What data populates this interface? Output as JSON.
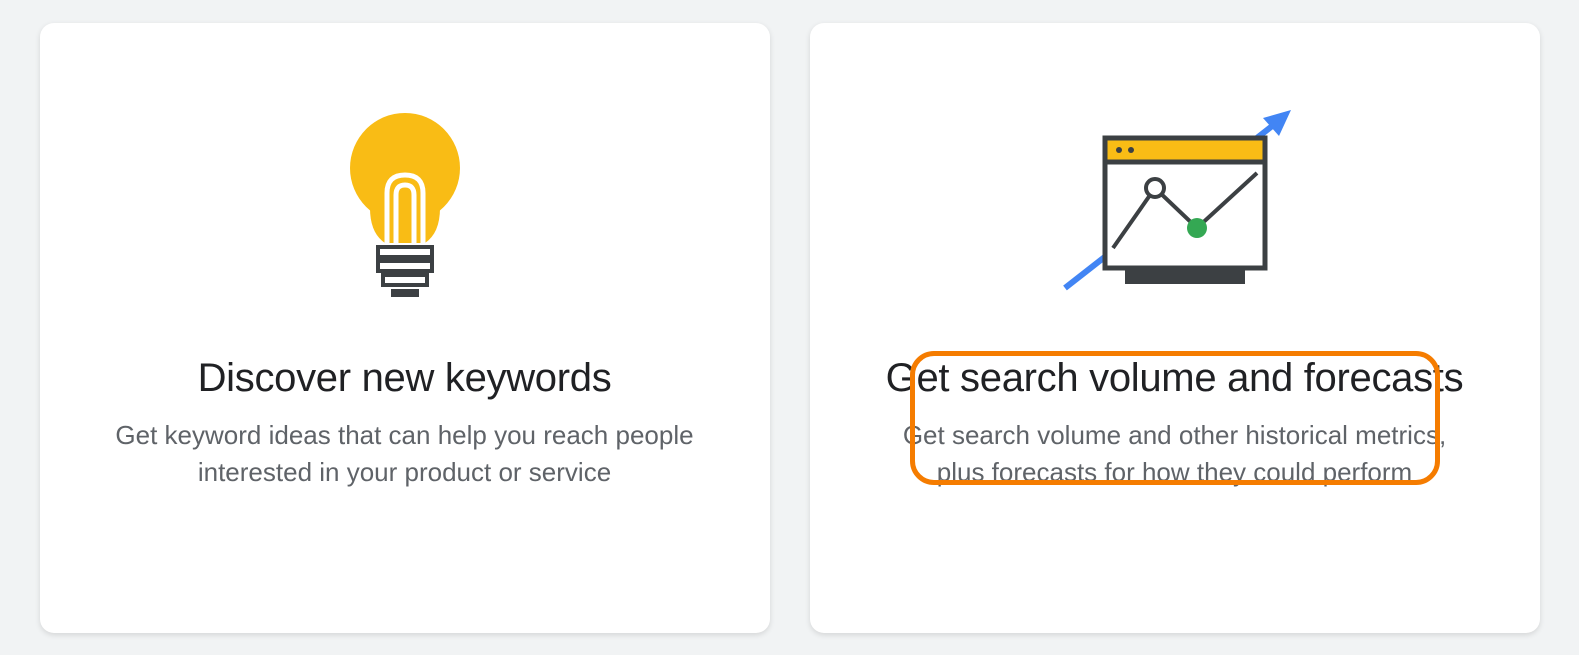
{
  "cards": [
    {
      "title": "Discover new keywords",
      "description": "Get keyword ideas that can help you reach people interested in your product or service"
    },
    {
      "title": "Get search volume and forecasts",
      "description": "Get search volume and other historical metrics, plus forecasts for how they could perform"
    }
  ],
  "colors": {
    "yellow": "#f9bc15",
    "blue": "#4285f4",
    "green": "#34a853",
    "dark": "#3c4043",
    "highlight": "#f57c00"
  }
}
